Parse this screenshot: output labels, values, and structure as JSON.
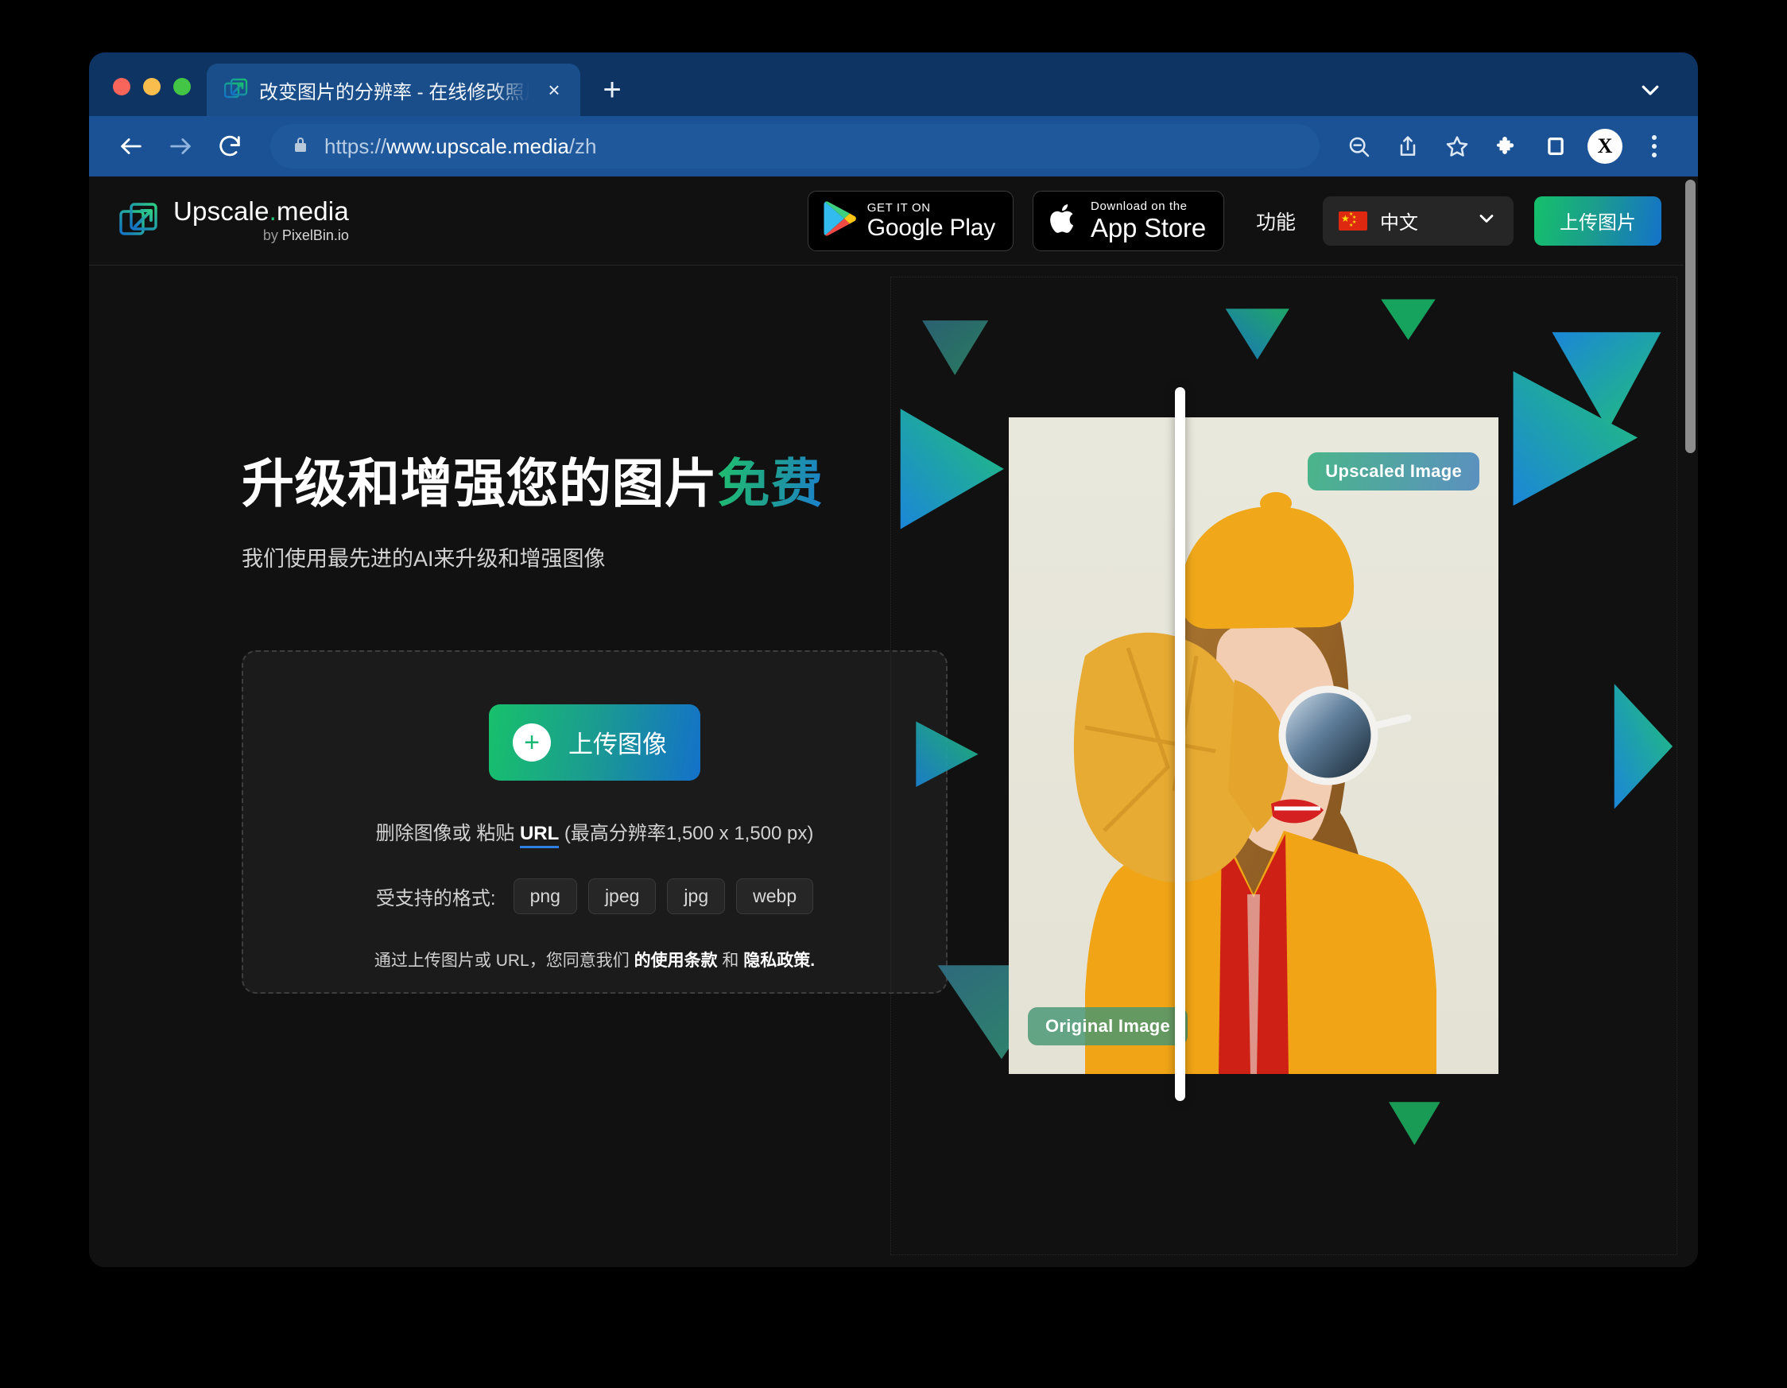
{
  "browser": {
    "tab": {
      "title": "改变图片的分辨率 - 在线修改照片",
      "favicon": "upscale-logo-icon",
      "close": "×"
    },
    "new_tab_label": "+",
    "toolbar": {
      "back": "back-arrow-icon",
      "forward": "forward-arrow-icon",
      "reload": "reload-icon",
      "lock": "lock-icon",
      "url_scheme": "https://",
      "url_host": "www.upscale.media",
      "url_path": "/zh",
      "zoom_out": "zoom-out-icon",
      "share": "share-icon",
      "bookmark": "star-icon",
      "extensions": "puzzle-icon",
      "side_panel": "sidebar-icon",
      "profile_initial": "X",
      "menu": "kebab-menu-icon"
    },
    "tab_search": "chevron-down-icon"
  },
  "site": {
    "brand": {
      "name_main": "Upscale",
      "name_dot": ".",
      "name_sub": "media",
      "by_prefix": "by ",
      "by_name": "PixelBin.io"
    },
    "google_play": {
      "small": "GET IT ON",
      "big": "Google Play"
    },
    "app_store": {
      "small": "Download on the",
      "big": "App Store"
    },
    "nav_link": "功能",
    "language": {
      "value": "中文",
      "chevron": "chevron-down-icon"
    },
    "cta": "上传图片",
    "accent_green": "#18c16b",
    "accent_blue": "#1471c9"
  },
  "hero": {
    "heading_main": "升级和增强您的图片",
    "heading_accent": "免费",
    "subtitle": "我们使用最先进的AI来升级和增强图像",
    "upload_button": "上传图像",
    "upload_plus": "+",
    "hint_prefix": "删除图像或 粘贴 ",
    "hint_link": "URL",
    "hint_suffix": " (最高分辨率1,500 x 1,500 px)",
    "formats_label": "受支持的格式:",
    "formats": [
      "png",
      "jpeg",
      "jpg",
      "webp"
    ],
    "terms_prefix": "通过上传图片或 URL，您同意我们 ",
    "terms_link1": "的使用条款",
    "terms_middle": " 和 ",
    "terms_link2": "隐私政策.",
    "badge_upscaled": "Upscaled Image",
    "badge_original": "Original Image"
  }
}
